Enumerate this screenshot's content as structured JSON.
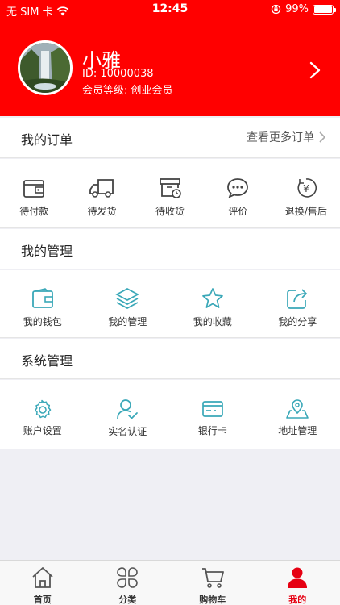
{
  "status_bar": {
    "carrier": "无 SIM 卡",
    "time": "12:45",
    "battery": "99%",
    "battery_level": 0.99
  },
  "profile": {
    "name": "小雅",
    "id_text": "ID: 10000038",
    "level_text": "会员等级: 创业会员"
  },
  "orders": {
    "title": "我的订单",
    "more_label": "查看更多订单",
    "items": [
      {
        "label": "待付款",
        "icon": "wallet-icon"
      },
      {
        "label": "待发货",
        "icon": "truck-icon"
      },
      {
        "label": "待收货",
        "icon": "box-clock-icon"
      },
      {
        "label": "评价",
        "icon": "chat-bubble-icon"
      },
      {
        "label": "退换/售后",
        "icon": "yen-return-icon"
      }
    ]
  },
  "management": {
    "title": "我的管理",
    "items": [
      {
        "label": "我的钱包",
        "icon": "wallet-icon"
      },
      {
        "label": "我的管理",
        "icon": "layers-icon"
      },
      {
        "label": "我的收藏",
        "icon": "star-icon"
      },
      {
        "label": "我的分享",
        "icon": "share-icon"
      }
    ]
  },
  "system": {
    "title": "系统管理",
    "items": [
      {
        "label": "账户设置",
        "icon": "gear-icon"
      },
      {
        "label": "实名认证",
        "icon": "user-check-icon"
      },
      {
        "label": "银行卡",
        "icon": "bank-card-icon"
      },
      {
        "label": "地址管理",
        "icon": "location-pin-icon"
      }
    ]
  },
  "tabbar": {
    "items": [
      {
        "label": "首页",
        "icon": "home-icon"
      },
      {
        "label": "分类",
        "icon": "grid-icon"
      },
      {
        "label": "购物车",
        "icon": "cart-icon"
      },
      {
        "label": "我的",
        "icon": "person-icon"
      }
    ],
    "active_index": 3
  },
  "colors": {
    "brand_red": "#ff0000",
    "accent_teal": "#3aa8b8",
    "active_tab": "#e60012"
  }
}
